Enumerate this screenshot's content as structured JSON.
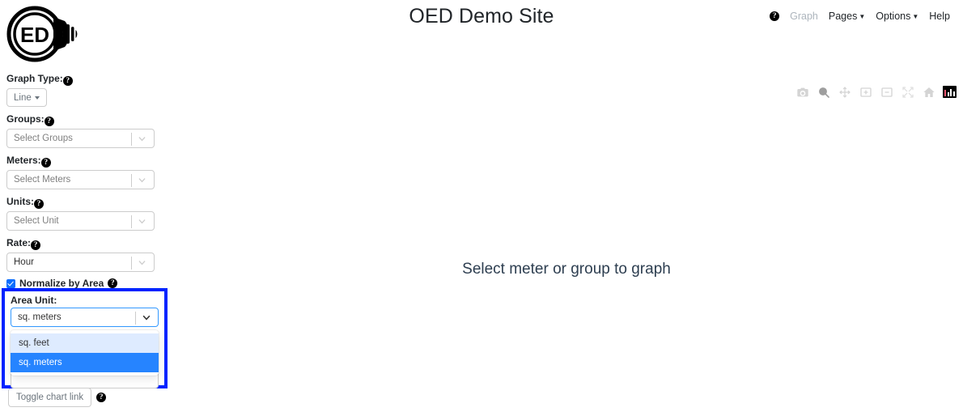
{
  "header": {
    "logo_alt": "OED lightbulb logo",
    "logo_text": "ED",
    "title": "OED Demo Site",
    "nav": [
      {
        "label": "Graph",
        "icon": "help-icon",
        "state": "disabled",
        "has_caret": false
      },
      {
        "label": "Pages",
        "state": "enabled",
        "has_caret": true
      },
      {
        "label": "Options",
        "state": "enabled",
        "has_caret": true
      },
      {
        "label": "Help",
        "state": "enabled",
        "has_caret": false
      }
    ]
  },
  "sidebar": {
    "graph_type": {
      "label": "Graph Type:",
      "value": "Line"
    },
    "groups": {
      "label": "Groups:",
      "placeholder": "Select Groups",
      "value": ""
    },
    "meters": {
      "label": "Meters:",
      "placeholder": "Select Meters",
      "value": ""
    },
    "units": {
      "label": "Units:",
      "placeholder": "Select Unit",
      "value": ""
    },
    "rate": {
      "label": "Rate:",
      "value": "Hour"
    },
    "normalize": {
      "label": "Normalize by Area",
      "checked": true
    },
    "area_unit": {
      "label": "Area Unit:",
      "value": "sq. meters",
      "options": [
        {
          "label": "sq. feet",
          "state": "focused"
        },
        {
          "label": "sq. meters",
          "state": "selected"
        }
      ]
    },
    "toggle_chart_link": {
      "label": "Toggle chart link"
    }
  },
  "main": {
    "placeholder_text": "Select meter or group to graph",
    "modebar": [
      {
        "name": "download-camera-icon",
        "title": "Download plot as a png"
      },
      {
        "name": "zoom-magnifier-icon",
        "title": "Zoom"
      },
      {
        "name": "pan-move-icon",
        "title": "Pan"
      },
      {
        "name": "zoom-in-icon",
        "title": "Zoom in"
      },
      {
        "name": "zoom-out-icon",
        "title": "Zoom out"
      },
      {
        "name": "autoscale-icon",
        "title": "Autoscale"
      },
      {
        "name": "reset-home-icon",
        "title": "Reset axes"
      },
      {
        "name": "plotly-logo-icon",
        "title": "Produced with Plotly"
      }
    ]
  },
  "colors": {
    "highlight_border": "#0023ff",
    "selected_option_bg": "#2684ff",
    "focused_option_bg": "#deebff",
    "focus_border": "#3399ff",
    "checkbox_blue": "#0d6efd",
    "title_text": "#212529",
    "placeholder_text": "#2d3e50"
  }
}
